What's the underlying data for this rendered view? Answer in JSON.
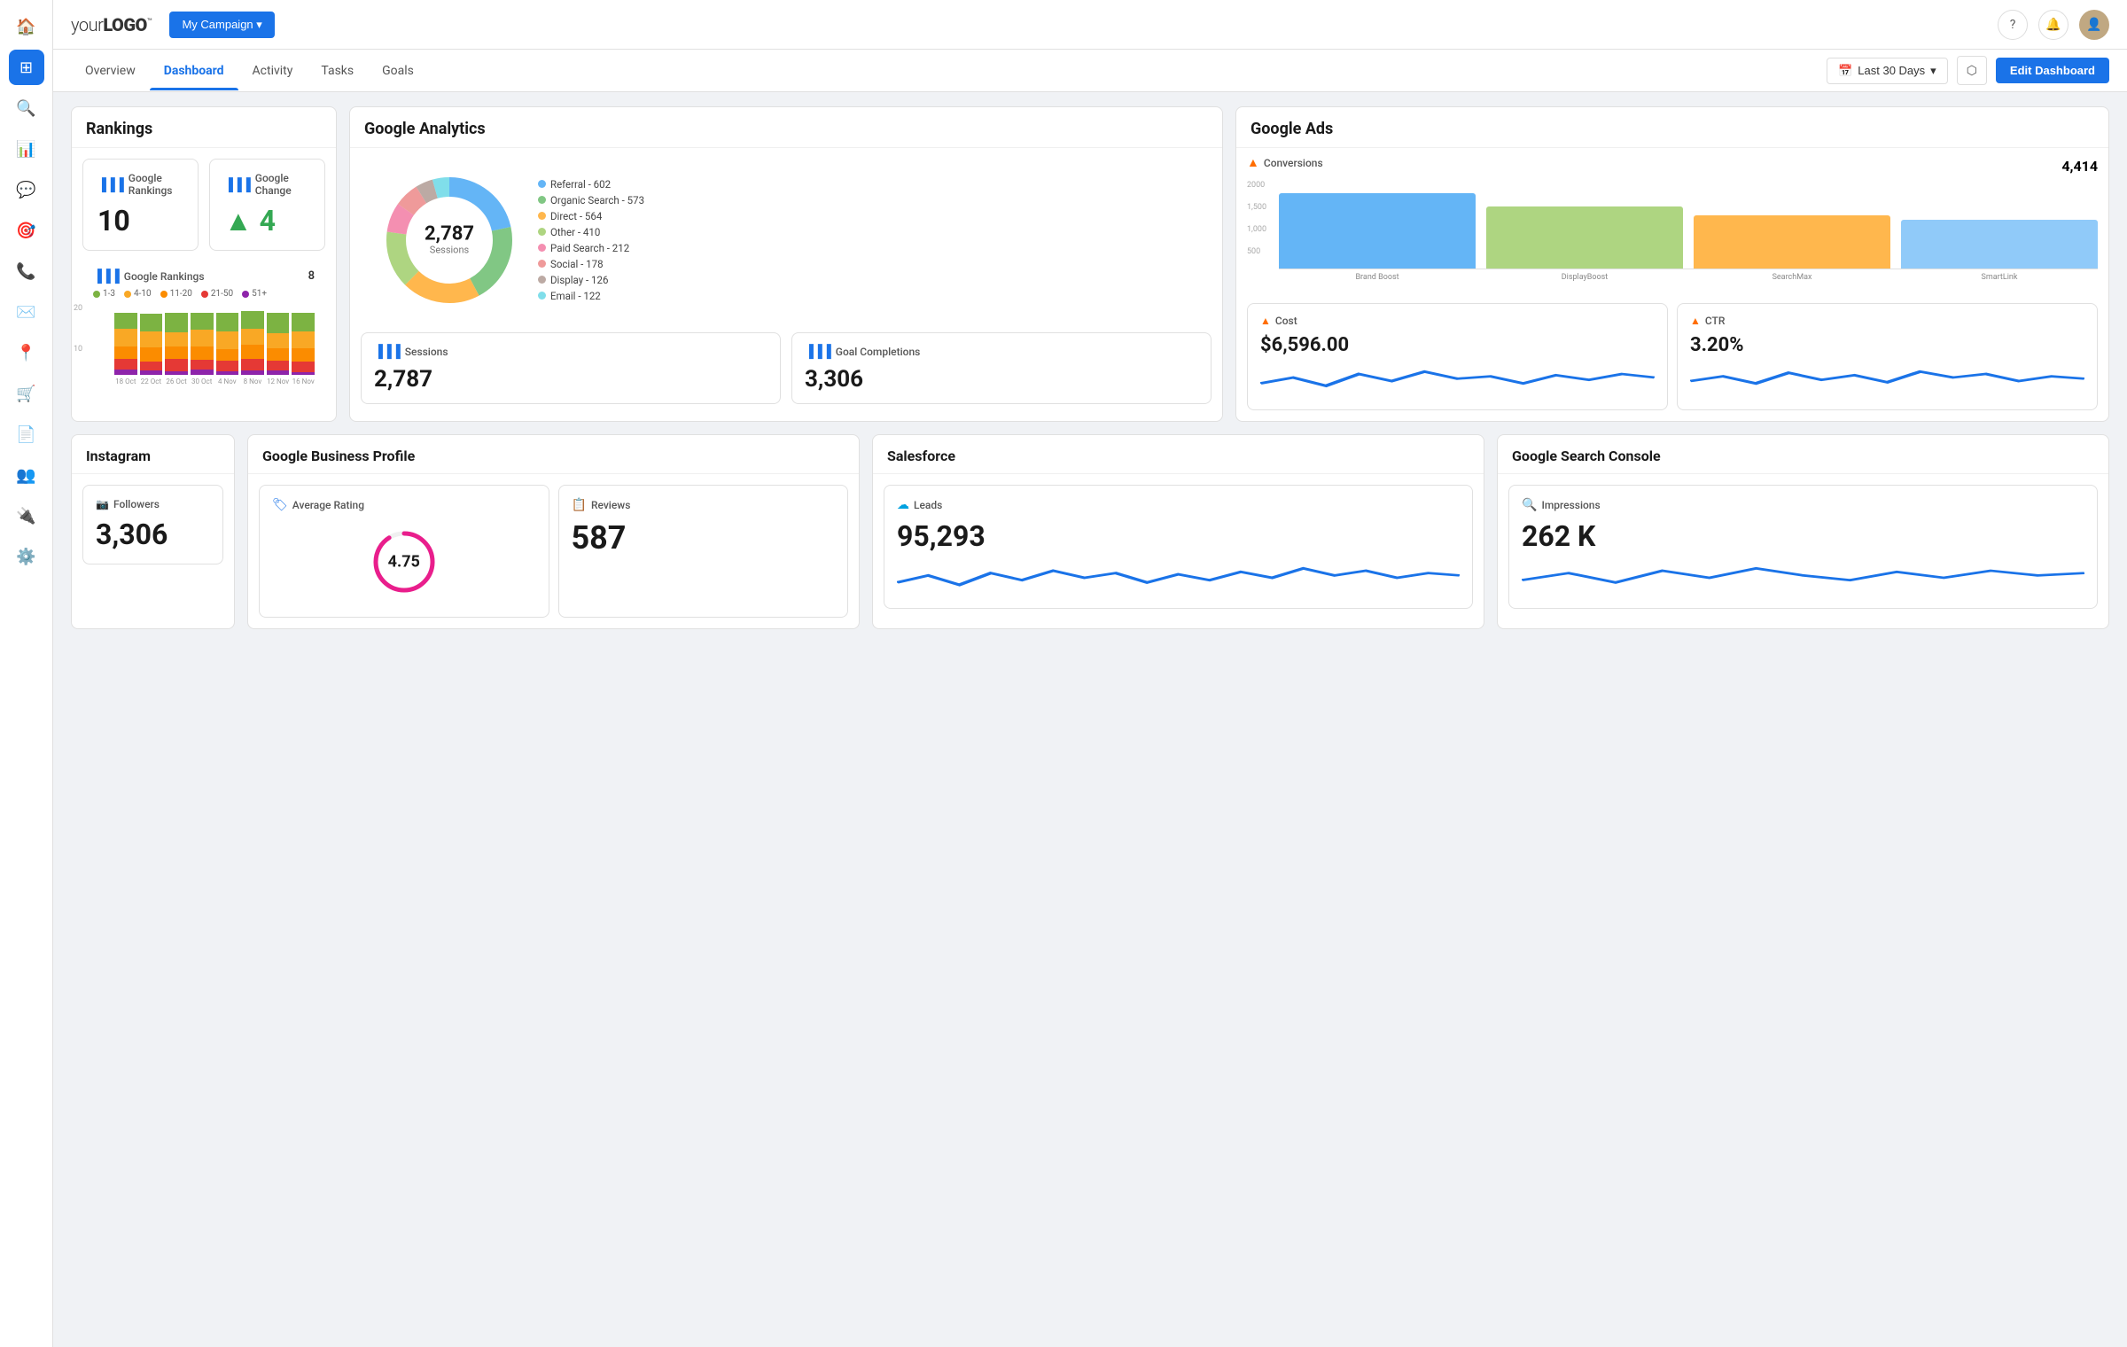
{
  "logo": {
    "text_light": "your",
    "text_bold": "LOGO",
    "trademark": "™"
  },
  "campaign_btn": "My Campaign ▾",
  "topbar_icons": {
    "help": "?",
    "notifications": "🔔",
    "avatar": "👤"
  },
  "nav": {
    "tabs": [
      "Overview",
      "Dashboard",
      "Activity",
      "Tasks",
      "Goals"
    ],
    "active": "Dashboard"
  },
  "toolbar": {
    "date_label": "Last 30 Days",
    "share_label": "⋮⋮",
    "edit_label": "Edit Dashboard"
  },
  "rankings": {
    "title": "Rankings",
    "google_rankings_title": "Google Rankings",
    "google_rankings_value": "10",
    "google_change_title": "Google Change",
    "google_change_value": "▲ 4",
    "chart_title": "Google Rankings",
    "chart_num": "8",
    "legend": [
      {
        "label": "1-3",
        "color": "#7cb342"
      },
      {
        "label": "4-10",
        "color": "#f9a825"
      },
      {
        "label": "11-20",
        "color": "#fb8c00"
      },
      {
        "label": "21-50",
        "color": "#e53935"
      },
      {
        "label": "51+",
        "color": "#8e24aa"
      }
    ],
    "x_labels": [
      "18 Oct",
      "22 Oct",
      "26 Oct",
      "30 Oct",
      "4 Nov",
      "8 Nov",
      "12 Nov",
      "16 Nov"
    ]
  },
  "google_analytics": {
    "title": "Google Analytics",
    "sessions_title": "Sessions",
    "sessions_value": "2,787",
    "sessions_label": "Sessions",
    "donut_segments": [
      {
        "label": "Referral",
        "value": 602,
        "color": "#64b5f6"
      },
      {
        "label": "Organic Search",
        "value": 573,
        "color": "#81c784"
      },
      {
        "label": "Direct",
        "value": 564,
        "color": "#ffb74d"
      },
      {
        "label": "Other",
        "value": 410,
        "color": "#aed581"
      },
      {
        "label": "Paid Search",
        "value": 212,
        "color": "#f48fb1"
      },
      {
        "label": "Social",
        "value": 178,
        "color": "#e57373"
      },
      {
        "label": "Display",
        "value": 126,
        "color": "#bcaaa4"
      },
      {
        "label": "Email",
        "value": 122,
        "color": "#80deea"
      }
    ],
    "goal_completions_title": "Goal Completions",
    "goal_completions_value": "3,306",
    "sessions_mini_title": "Sessions",
    "sessions_mini_value": "2,787"
  },
  "google_ads": {
    "title": "Google Ads",
    "conversions_title": "Conversions",
    "conversions_value": "4,414",
    "bars": [
      {
        "label": "Brand Boost",
        "value": 1700,
        "color": "#64b5f6"
      },
      {
        "label": "DisplayBoost",
        "value": 1400,
        "color": "#aed581"
      },
      {
        "label": "SearchMax",
        "value": 1200,
        "color": "#ffb74d"
      },
      {
        "label": "SmartLink",
        "value": 1100,
        "color": "#90caf9"
      }
    ],
    "y_labels": [
      "2000",
      "1,500",
      "1,000",
      "500",
      ""
    ],
    "cost_title": "Cost",
    "cost_value": "$6,596.00",
    "ctr_title": "CTR",
    "ctr_value": "3.20%"
  },
  "instagram": {
    "title": "Instagram",
    "followers_title": "Followers",
    "followers_value": "3,306"
  },
  "google_business": {
    "title": "Google Business Profile",
    "avg_rating_title": "Average Rating",
    "avg_rating_value": "4.75",
    "reviews_title": "Reviews",
    "reviews_value": "587"
  },
  "salesforce": {
    "title": "Salesforce",
    "leads_title": "Leads",
    "leads_value": "95,293"
  },
  "gsc": {
    "title": "Google Search Console",
    "impressions_title": "Impressions",
    "impressions_value": "262 K"
  },
  "colors": {
    "primary": "#1a73e8",
    "positive": "#34a853",
    "accent1": "#64b5f6",
    "accent2": "#81c784",
    "accent3": "#ffb74d"
  }
}
